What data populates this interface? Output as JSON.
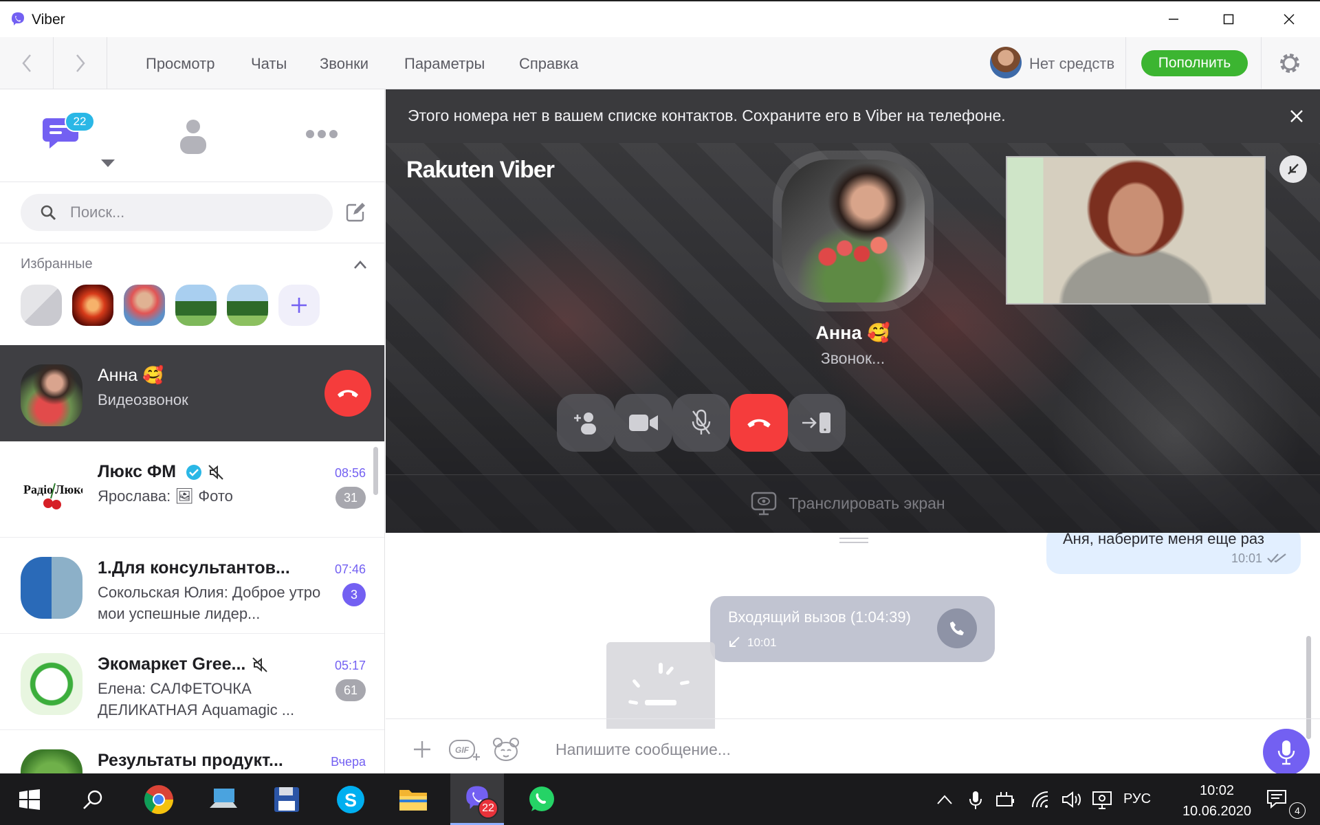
{
  "window": {
    "title": "Viber",
    "logo_icon": "viber-logo-icon"
  },
  "menu": {
    "items": [
      "Просмотр",
      "Чаты",
      "Звонки",
      "Параметры",
      "Справка"
    ],
    "balance": "Нет средств",
    "topup": "Пополнить"
  },
  "sidebar": {
    "unread_badge": "22",
    "search_placeholder": "Поиск...",
    "favorites_title": "Избранные",
    "chats": [
      {
        "name": "Анна 🥰",
        "preview": "Видеозвонок",
        "state": "active-call"
      },
      {
        "name": "Люкс ФМ",
        "preview": "Ярослава: 🖼 Фото",
        "time": "08:56",
        "count": "31",
        "verified": true,
        "muted": true
      },
      {
        "name": "1.Для консультантов...",
        "preview": "Сокольская Юлия: Доброе утро мои успешные лидер...",
        "time": "07:46",
        "count": "3"
      },
      {
        "name": "Экомаркет Gree...",
        "preview": "Елена: САЛФЕТОЧКА ДЕЛИКАТНАЯ Aquamagic ...",
        "time": "05:17",
        "count": "61",
        "muted": true
      },
      {
        "name": "Результаты продукт...",
        "preview": "",
        "time": "Вчера"
      }
    ]
  },
  "call": {
    "notice": "Этого номера нет в вашем списке контактов. Сохраните его в Viber на телефоне.",
    "brand": "Rakuten Viber",
    "caller_name": "Анна 🥰",
    "status": "Звонок...",
    "screen_share": "Транслировать экран"
  },
  "conversation": {
    "outgoing_text": "Аня, наберите меня еще раз",
    "outgoing_time": "10:01",
    "call_event_title": "Входящий вызов (1:04:39)",
    "call_event_time": "10:01",
    "composer_placeholder": "Напишите сообщение..."
  },
  "taskbar": {
    "viber_badge": "22",
    "language": "РУС",
    "time": "10:02",
    "date": "10.06.2020",
    "notifications": "4"
  },
  "colors": {
    "viber_purple": "#7360f2",
    "topup_green": "#3cb531",
    "end_call_red": "#f53c3c",
    "badge_blue": "#2ab7e6"
  }
}
